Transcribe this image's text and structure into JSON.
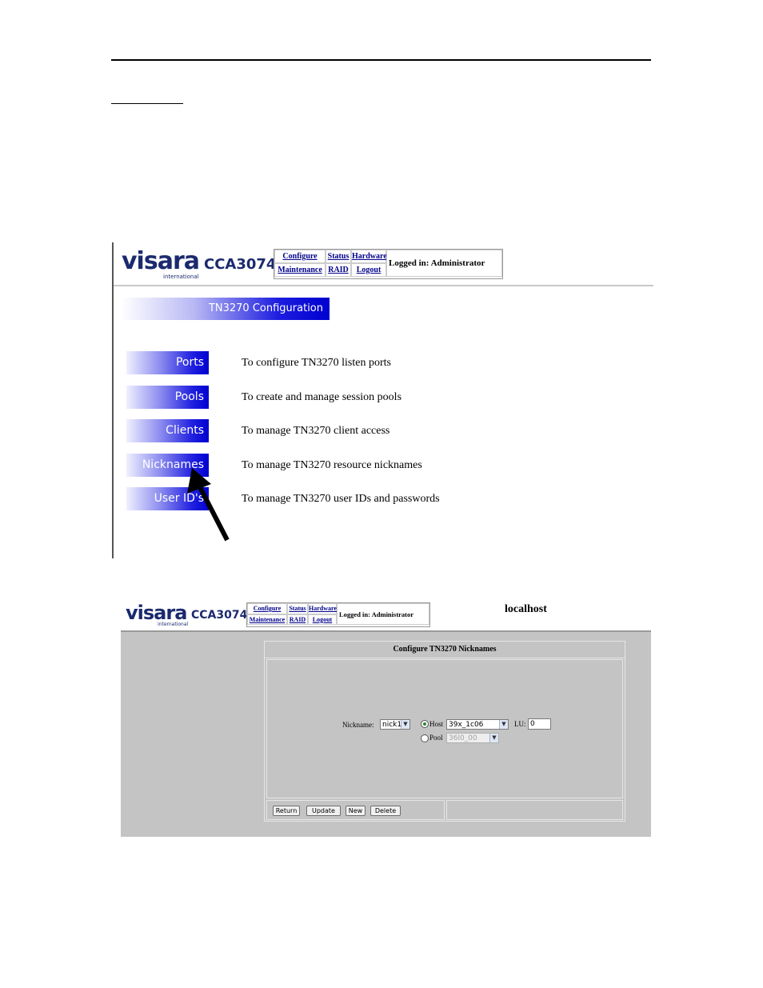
{
  "brand": {
    "word": "visara",
    "sub": "international",
    "model": "CCA3074"
  },
  "nav": {
    "configure": "Configure",
    "status": "Status",
    "hardware": "Hardware",
    "maintenance": "Maintenance",
    "raid": "RAID",
    "logout": "Logout",
    "logged_in": "Logged in: Administrator"
  },
  "screen1": {
    "banner": "TN3270 Configuration",
    "items": [
      {
        "label": "Ports",
        "desc": "To configure TN3270 listen ports"
      },
      {
        "label": "Pools",
        "desc": "To create and manage session pools"
      },
      {
        "label": "Clients",
        "desc": "To manage TN3270 client access"
      },
      {
        "label": "Nicknames",
        "desc": "To manage TN3270 resource nicknames"
      },
      {
        "label": "User ID's",
        "desc": "To manage TN3270 user IDs and passwords"
      }
    ]
  },
  "screen2": {
    "hostname": "localhost",
    "panel_title": "Configure TN3270 Nicknames",
    "nickname_label": "Nickname:",
    "nickname_value": "nick1",
    "host_label": "Host",
    "host_value": "39x_1c06",
    "lu_label": "LU:",
    "lu_value": "0",
    "pool_label": "Pool",
    "pool_value": "36l0_00",
    "buttons": {
      "return": "Return",
      "update": "Update",
      "new": "New",
      "delete": "Delete"
    }
  }
}
